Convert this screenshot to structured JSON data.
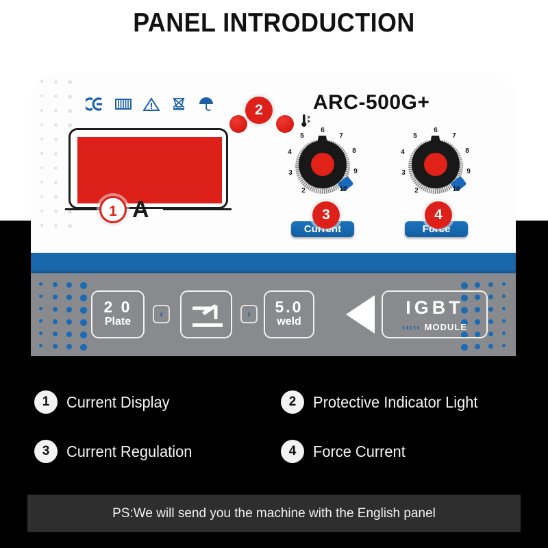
{
  "page": {
    "title": "PANEL INTRODUCTION",
    "background_color": "#000000",
    "accent_red": "#dd2019",
    "accent_blue": "#1a68ac",
    "panel_gray": "#898a8d"
  },
  "panel": {
    "model_name": "ARC-500G+",
    "cert_icons": [
      "ce-mark-icon",
      "read-manual-book-icon",
      "warning-triangle-icon",
      "weee-crossed-bin-icon",
      "keep-dry-umbrella-icon"
    ],
    "indicators": {
      "led_left": "power-led-indicator",
      "led_right": "protection-led-indicator",
      "thermometer_icon": "thermometer-icon"
    },
    "display": {
      "unit_label": "A",
      "screen_color": "#dd2019"
    },
    "knobs": [
      {
        "id": "current-knob",
        "badge_label": "Current",
        "scale_numbers": [
          "2",
          "3",
          "4",
          "5",
          "6",
          "7",
          "8",
          "9",
          "10"
        ],
        "pointer_color": "#1668b8",
        "cap_color": "#e02218"
      },
      {
        "id": "force-knob",
        "badge_label": "Force",
        "scale_numbers": [
          "2",
          "3",
          "4",
          "5",
          "6",
          "7",
          "8",
          "9",
          "10"
        ],
        "pointer_color": "#1668b8",
        "cap_color": "#e02218"
      }
    ],
    "lower_controls": {
      "plate_value": "2 0",
      "plate_label": "Plate",
      "prev_arrow": "‹",
      "electrode_icon": "welding-electrode-icon",
      "next_arrow": "›",
      "weld_value": "5.0",
      "weld_label": "weld",
      "play_icon": "left-triangle-icon",
      "igbt_title": "IGBT",
      "igbt_chevrons": "‹‹‹‹‹",
      "igbt_module": "MODULE"
    }
  },
  "callouts": [
    {
      "number": "1",
      "style": "hollow",
      "target": "current-display"
    },
    {
      "number": "2",
      "style": "solid",
      "target": "protective-indicator-light"
    },
    {
      "number": "3",
      "style": "solid",
      "target": "current-regulation-knob"
    },
    {
      "number": "4",
      "style": "solid",
      "target": "force-current-knob"
    }
  ],
  "legend": [
    {
      "number": "1",
      "label": "Current Display"
    },
    {
      "number": "2",
      "label": "Protective Indicator Light"
    },
    {
      "number": "3",
      "label": "Current Regulation"
    },
    {
      "number": "4",
      "label": "Force Current"
    }
  ],
  "footer": {
    "note": "PS:We will send you the machine with the English panel"
  }
}
